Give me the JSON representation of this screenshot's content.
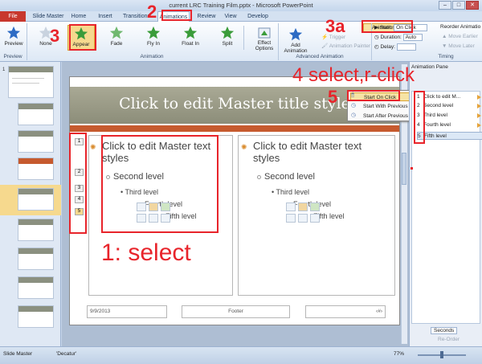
{
  "window": {
    "title": "current LRC Training Film.pptx - Microsoft PowerPoint",
    "minimize": "–",
    "maximize": "□",
    "close": "✕"
  },
  "tabs": [
    {
      "label": "File"
    },
    {
      "label": "Slide Master"
    },
    {
      "label": "Home"
    },
    {
      "label": "Insert"
    },
    {
      "label": "Transitions"
    },
    {
      "label": "Animations"
    },
    {
      "label": "Review"
    },
    {
      "label": "View"
    },
    {
      "label": "Develop"
    }
  ],
  "ribbon": {
    "preview": {
      "label": "Preview",
      "group": "Preview"
    },
    "effects": [
      {
        "label": "None"
      },
      {
        "label": "Appear"
      },
      {
        "label": "Fade"
      },
      {
        "label": "Fly In"
      },
      {
        "label": "Float In"
      },
      {
        "label": "Split"
      }
    ],
    "animation_group": "Animation",
    "effect_options": "Effect Options",
    "add_animation": "Add Animation",
    "trigger": "Trigger",
    "animation_painter": "Animation Painter",
    "animation_pane": "Animation Pane",
    "advanced_group": "Advanced Animation",
    "start_label": "Start:",
    "start_value": "On Click",
    "duration_label": "Duration:",
    "duration_value": "Auto",
    "delay_label": "Delay:",
    "delay_value": "",
    "timing_group": "Timing",
    "reorder_label": "Reorder Animatio",
    "move_earlier": "Move Earlier",
    "move_later": "Move Later"
  },
  "slide": {
    "title": "Click to edit Master title style",
    "left_body": {
      "level1": "Click to edit Master text styles",
      "level2": "Second level",
      "level3": "Third level",
      "level4": "Fourth level",
      "level5": "Fifth level"
    },
    "right_body": {
      "level1": "Click to edit Master text styles",
      "level2": "Second level",
      "level3": "Third level",
      "level4": "Fourth level",
      "level5": "Fifth level"
    },
    "anim_tags": [
      "1",
      "2",
      "3",
      "4",
      "5"
    ],
    "footer_date": "9/9/2013",
    "footer_center": "Footer",
    "footer_num": "‹#›"
  },
  "context_menu": {
    "items": [
      {
        "label": "Start On Click"
      },
      {
        "label": "Start With Previous"
      },
      {
        "label": "Start After Previous"
      }
    ]
  },
  "animation_pane": {
    "title": "Animation Pane",
    "items": [
      {
        "num": "1",
        "label": "Click to edit M..."
      },
      {
        "num": "2",
        "label": "Second level"
      },
      {
        "num": "3",
        "label": "Third level"
      },
      {
        "num": "4",
        "label": "Fourth level"
      },
      {
        "num": "5",
        "label": "Fifth level"
      }
    ],
    "seconds_label": "Seconds",
    "reorder_label": "Re-Order"
  },
  "status": {
    "view": "Slide Master",
    "theme": "'Decatur'",
    "zoom": "77%"
  },
  "annotations": {
    "a1": "1: select",
    "a2": "2",
    "a3": "3",
    "a3a": "3a",
    "a4": "4 select,r-click",
    "a5": "5"
  },
  "colors": {
    "accent_red": "#e8242b",
    "file_tab": "#c8372d",
    "highlight": "#f6d98e"
  }
}
